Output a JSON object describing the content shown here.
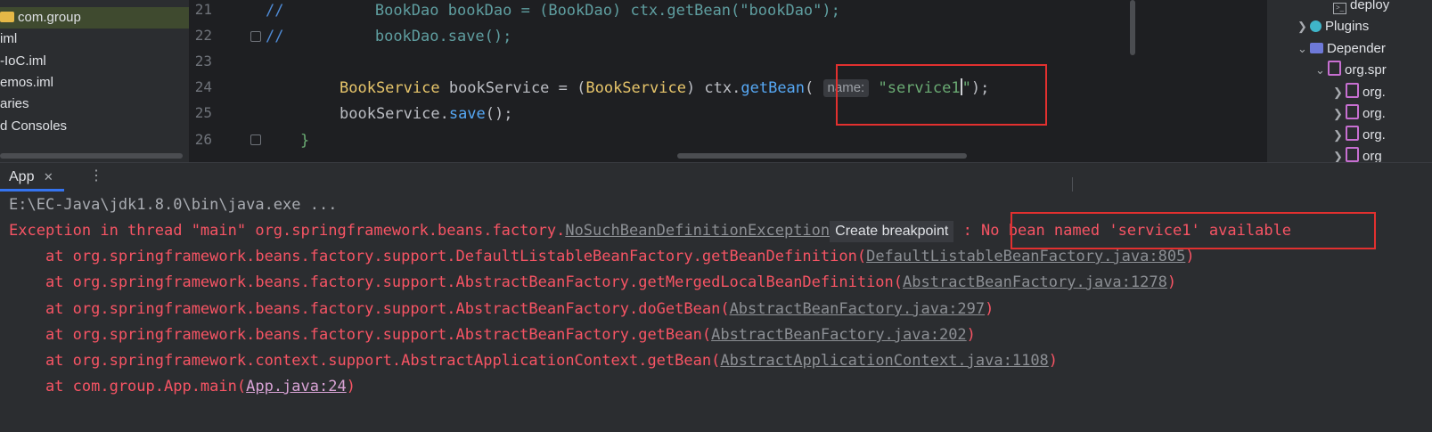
{
  "project_tree": {
    "items": [
      {
        "label": "com.group",
        "selected": true
      },
      {
        "label": "iml"
      },
      {
        "label": "-IoC.iml"
      },
      {
        "label": "emos.iml"
      },
      {
        "label": "aries"
      },
      {
        "label": "d Consoles"
      }
    ]
  },
  "editor": {
    "line_numbers": [
      "21",
      "22",
      "23",
      "24",
      "25",
      "26"
    ],
    "line21": {
      "comment": "//",
      "type": "BookDao",
      "var": " bookDao = (",
      "cast": "BookDao",
      "rest1": ") ctx.getBean(",
      "str": "\"bookDao\"",
      "rest2": ");"
    },
    "line22": {
      "comment": "//",
      "text": "bookDao.save();"
    },
    "line24": {
      "type": "BookService",
      "var": " bookService = (",
      "cast": "BookService",
      "mid": ") ctx.",
      "method": "getBean",
      "open": "(",
      "hint": "name:",
      "str_a": "\"service1",
      "str_b": "\"",
      "close": ");"
    },
    "line25": {
      "obj": "bookService.",
      "method": "save",
      "close": "();"
    },
    "line26": {
      "brace": "}"
    }
  },
  "right_tree": {
    "items": [
      {
        "label": "deploy",
        "icon": "terminal-icon"
      },
      {
        "label": "Plugins",
        "icon": "plugin-icon"
      },
      {
        "label": "Depender",
        "icon": "dependencies-icon"
      },
      {
        "label": "org.spr",
        "icon": "library-icon"
      },
      {
        "label": "org.",
        "icon": "library-icon"
      },
      {
        "label": "org.",
        "icon": "library-icon"
      },
      {
        "label": "org.",
        "icon": "library-icon"
      },
      {
        "label": "org",
        "icon": "library-icon"
      }
    ]
  },
  "run_window": {
    "tab_label": "App",
    "close_glyph": "✕",
    "more_glyph": "⋮"
  },
  "console": {
    "cmd": "E:\\EC-Java\\jdk1.8.0\\bin\\java.exe ...",
    "exc_prefix": "Exception in thread \"main\" org.springframework.beans.factory.",
    "exc_class": "NoSuchBeanDefinitionException",
    "tooltip": "Create breakpoint",
    "exc_colon": " : ",
    "exc_message": "No bean named 'service1' available",
    "frames": [
      {
        "text": "    at org.springframework.beans.factory.support.DefaultListableBeanFactory.getBeanDefinition(",
        "link": "DefaultListableBeanFactory.java:805",
        "end": ")"
      },
      {
        "text": "    at org.springframework.beans.factory.support.AbstractBeanFactory.getMergedLocalBeanDefinition(",
        "link": "AbstractBeanFactory.java:1278",
        "end": ")"
      },
      {
        "text": "    at org.springframework.beans.factory.support.AbstractBeanFactory.doGetBean(",
        "link": "AbstractBeanFactory.java:297",
        "end": ")"
      },
      {
        "text": "    at org.springframework.beans.factory.support.AbstractBeanFactory.getBean(",
        "link": "AbstractBeanFactory.java:202",
        "end": ")"
      },
      {
        "text": "    at org.springframework.context.support.AbstractApplicationContext.getBean(",
        "link": "AbstractApplicationContext.java:1108",
        "end": ")"
      },
      {
        "text": "    at com.group.App.main(",
        "link": "App.java:24",
        "end": ")"
      }
    ]
  },
  "colors": {
    "error_red": "#f75464",
    "highlight_box": "#e2302f",
    "accent_blue": "#3574f0"
  }
}
